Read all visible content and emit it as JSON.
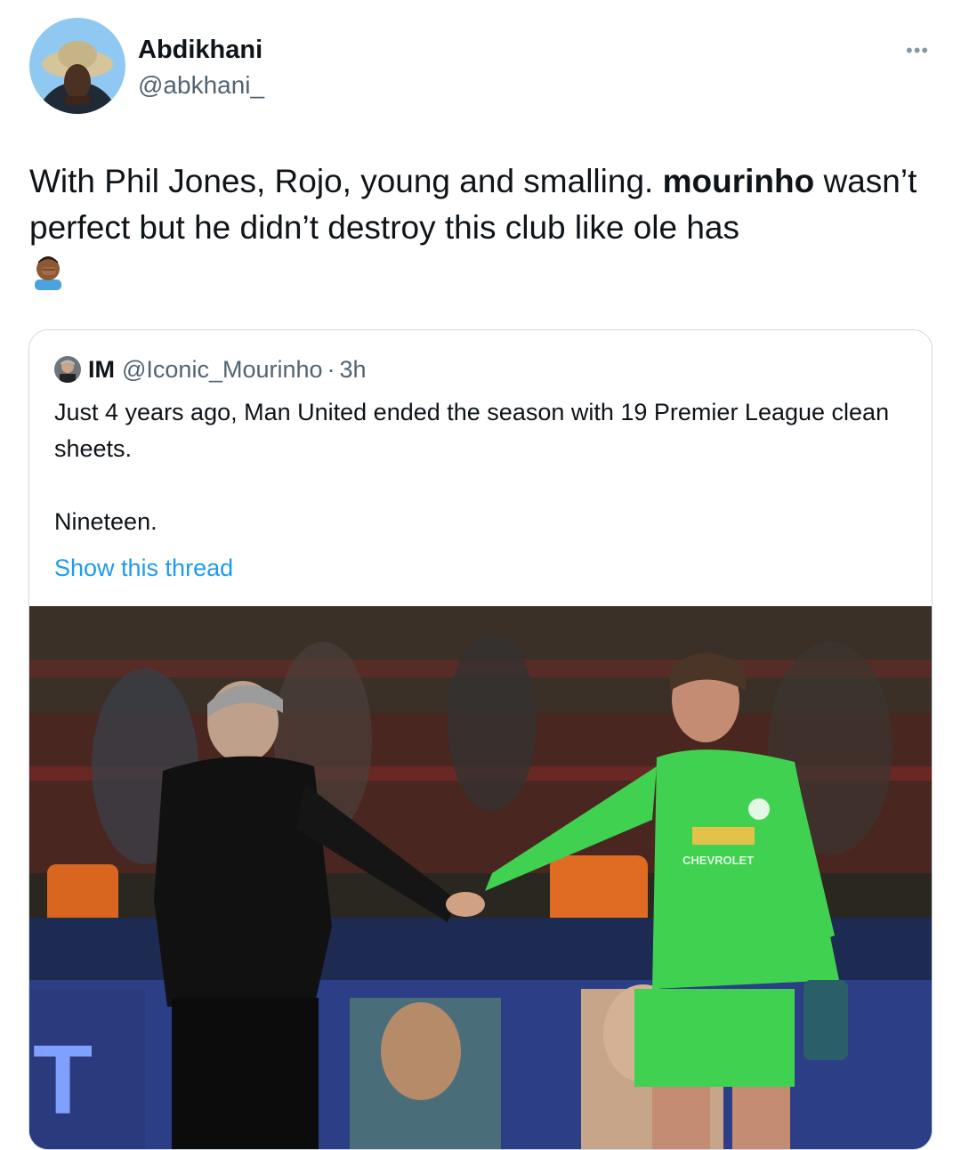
{
  "author": {
    "display_name": "Abdikhani",
    "handle": "@abkhani_"
  },
  "more_icon": "more-options-icon",
  "tweet": {
    "text_before": "With Phil Jones, Rojo, young and smalling. ",
    "text_bold": "mourinho",
    "text_after": " wasn’t perfect but he didn’t destroy this club like ole has",
    "emoji": "man-facepalming-emoji"
  },
  "quote": {
    "display_name": "IM",
    "handle": "@Iconic_Mourinho",
    "separator": "·",
    "time": "3h",
    "text": "Just 4 years ago, Man United ended the season with 19 Premier League clean sheets.\n\nNineteen.",
    "show_thread": "Show this thread",
    "image_alt": "Manager shaking hands with goalkeeper in green kit on pitch",
    "jersey_sponsor": "CHEVROLET"
  },
  "colors": {
    "text": "#0f1419",
    "secondary": "#536471",
    "link": "#1d9bf0",
    "border": "#cfd9de",
    "keeper_kit": "#3fd14f"
  }
}
